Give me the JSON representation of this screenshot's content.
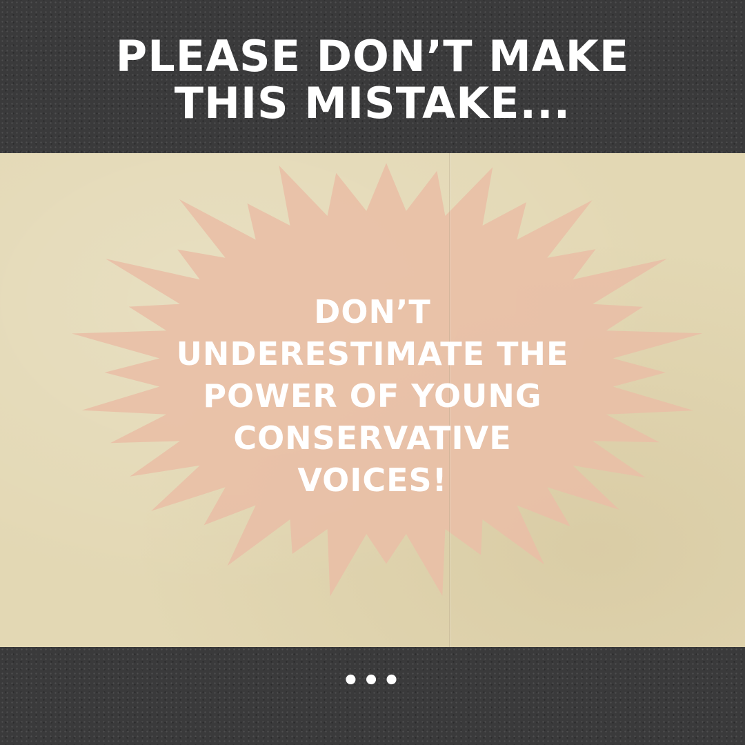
{
  "header": {
    "title_lines": [
      "PLEASE DON’T MAKE",
      "THIS MISTAKE..."
    ]
  },
  "burst": {
    "text_lines": [
      "DON’T",
      "UNDERESTIMATE THE",
      "POWER OF YOUNG",
      "CONSERVATIVE",
      "VOICES!"
    ]
  },
  "footer": {
    "ellipsis": "•••"
  },
  "colors": {
    "band": "#3a3a3b",
    "paper": "#e3d8b4",
    "burst": "#e9bfa6",
    "text": "#ffffff"
  }
}
